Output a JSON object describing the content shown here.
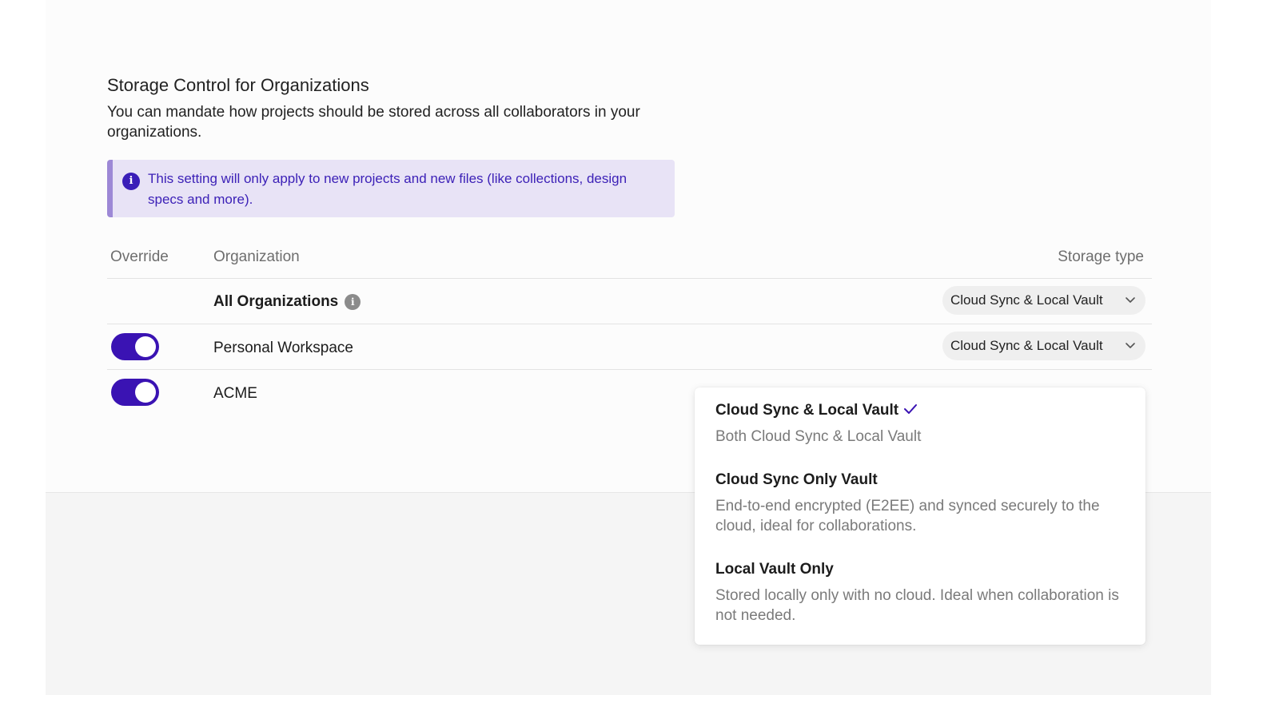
{
  "section": {
    "title": "Storage Control for Organizations",
    "description": "You can mandate how projects should be stored across all collaborators in your organizations."
  },
  "notice": {
    "icon": "info-icon",
    "text": "This setting will only apply to new projects and new files (like collections, design specs and more)."
  },
  "table": {
    "headers": {
      "override": "Override",
      "organization": "Organization",
      "storage_type": "Storage type"
    },
    "rows": [
      {
        "name": "All Organizations",
        "has_info_icon": true,
        "override": null,
        "storage": "Cloud Sync & Local Vault"
      },
      {
        "name": "Personal Workspace",
        "override": true,
        "storage": "Cloud Sync & Local Vault"
      },
      {
        "name": "ACME",
        "override": true,
        "storage": "Cloud Sync & Local Vault"
      }
    ]
  },
  "dropdown": {
    "selected": "Cloud Sync & Local Vault",
    "options": [
      {
        "title": "Cloud Sync & Local Vault",
        "description": "Both Cloud Sync & Local Vault",
        "selected": true
      },
      {
        "title": "Cloud Sync Only Vault",
        "description": "End-to-end encrypted (E2EE) and synced securely to the cloud, ideal for collaborations.",
        "selected": false
      },
      {
        "title": "Local Vault Only",
        "description": "Stored locally only with no cloud. Ideal when collaboration is not needed.",
        "selected": false
      }
    ]
  },
  "colors": {
    "accent": "#3a13b3",
    "notice_bg": "#e8e3f6",
    "notice_border": "#9d88d6",
    "notice_text": "#3c21b7"
  }
}
